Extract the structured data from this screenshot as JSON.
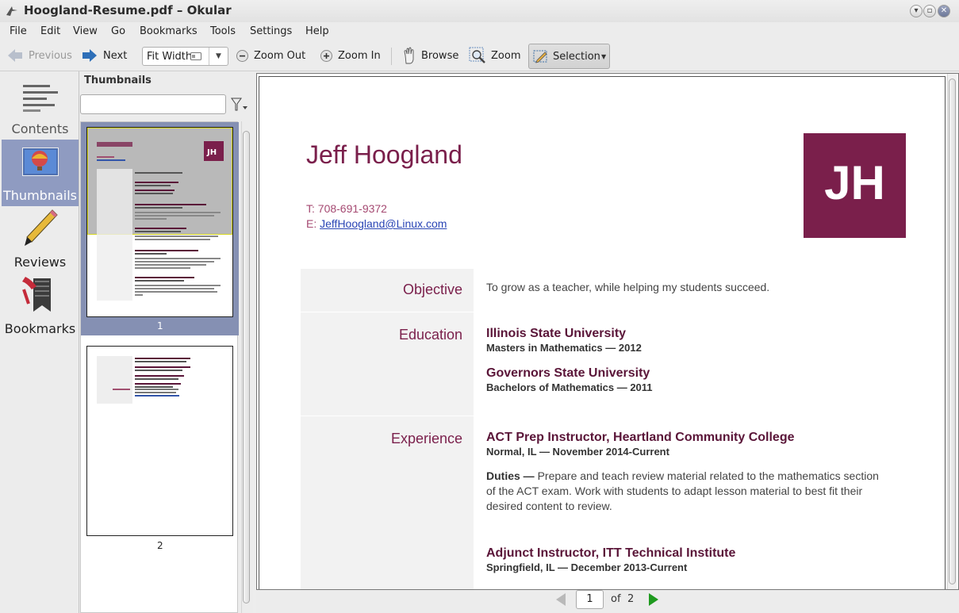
{
  "window": {
    "title": "Hoogland-Resume.pdf – Okular"
  },
  "menu": [
    "File",
    "Edit",
    "View",
    "Go",
    "Bookmarks",
    "Tools",
    "Settings",
    "Help"
  ],
  "toolbar": {
    "previous": "Previous",
    "next": "Next",
    "zoom_value": "Fit Width",
    "zoom_out": "Zoom Out",
    "zoom_in": "Zoom In",
    "browse": "Browse",
    "zoom": "Zoom",
    "selection": "Selection"
  },
  "sidebar": {
    "items": [
      {
        "label": "Contents",
        "icon": "contents-icon"
      },
      {
        "label": "Thumbnails",
        "icon": "thumbnails-icon",
        "active": true
      },
      {
        "label": "Reviews",
        "icon": "pencil-icon"
      },
      {
        "label": "Bookmarks",
        "icon": "bookmark-icon"
      }
    ]
  },
  "panel": {
    "title": "Thumbnails",
    "search_placeholder": ""
  },
  "thumbs": [
    {
      "number": "1",
      "selected": true
    },
    {
      "number": "2",
      "selected": false
    }
  ],
  "resume": {
    "name": "Jeff Hoogland",
    "initials": "JH",
    "phone": "T: 708-691-9372",
    "email_prefix": "E: ",
    "email": "JeffHoogland@Linux.com",
    "sections": {
      "objective": {
        "label": "Objective",
        "text": "To grow as a teacher, while helping my students succeed."
      },
      "education": {
        "label": "Education",
        "entries": [
          {
            "school": "Illinois State University",
            "degree": "Masters in Mathematics — 2012"
          },
          {
            "school": "Governors State University",
            "degree": "Bachelors of Mathematics — 2011"
          }
        ]
      },
      "experience": {
        "label": "Experience",
        "entries": [
          {
            "title": "ACT Prep Instructor, Heartland Community College",
            "where": "Normal, IL — November 2014-Current",
            "duties_label": "Duties —",
            "duties": " Prepare and teach review material related to the mathematics section of the ACT exam. Work with students to adapt lesson material to best fit their desired content to review."
          },
          {
            "title": "Adjunct Instructor, ITT Technical Institute",
            "where": "Springfield, IL — December 2013-Current"
          }
        ]
      }
    }
  },
  "pagenav": {
    "current": "1",
    "of": "of",
    "total": "2"
  },
  "colors": {
    "accent": "#7a1f4b",
    "selection": "#8f9bc1"
  }
}
